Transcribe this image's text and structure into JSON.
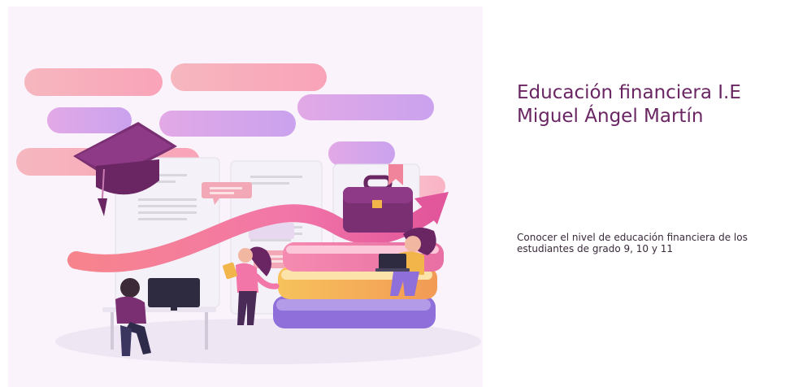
{
  "form": {
    "title": "Educación financiera I.E Miguel Ángel Martín",
    "description": "Conocer el nivel de educación financiera de los estudiantes de grado 9, 10 y 11"
  },
  "illustration": {
    "subject": "students-learning-finance",
    "icons": [
      "graduation-cap-icon",
      "briefcase-icon",
      "bookmark-icon",
      "growth-arrow-icon",
      "books-stack-icon",
      "computer-monitor-icon",
      "laptop-icon",
      "tablet-icon"
    ]
  },
  "theme": {
    "title_color": "#6a2563",
    "text_color": "#3a2a3a",
    "illustration_background": "#faf3fc",
    "accent_pink": "#f57aa6",
    "accent_purple": "#8a3a88"
  }
}
